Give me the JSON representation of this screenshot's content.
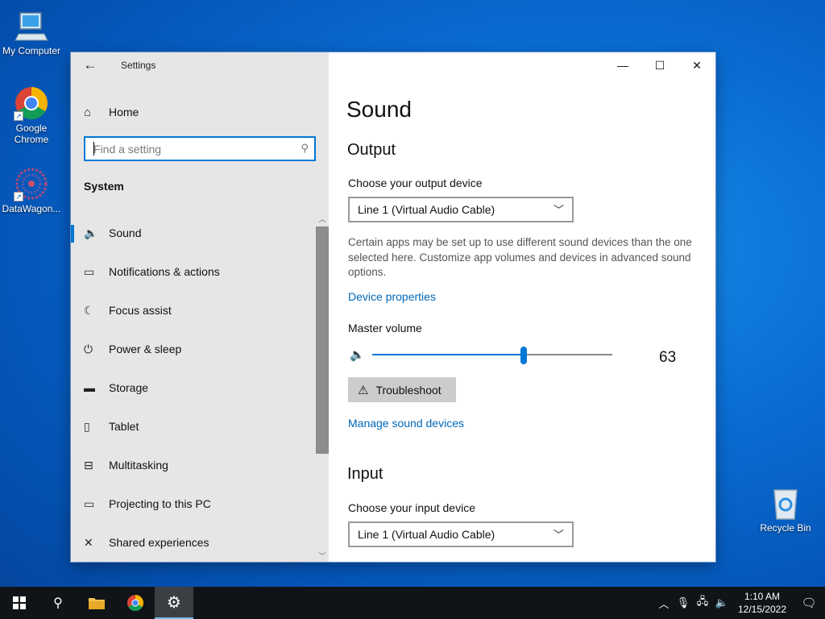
{
  "desktop": {
    "icons": [
      {
        "label": "My Computer",
        "icon": "computer-icon"
      },
      {
        "label": "Google Chrome",
        "icon": "chrome-icon"
      },
      {
        "label": "DataWagon...",
        "icon": "datawagon-icon"
      },
      {
        "label": "Recycle Bin",
        "icon": "recycle-bin-icon"
      }
    ]
  },
  "window": {
    "app_title": "Settings",
    "back_icon": "←",
    "minimize": "—",
    "maximize": "☐",
    "close": "✕"
  },
  "sidebar": {
    "home_label": "Home",
    "search_placeholder": "Find a setting",
    "section_title": "System",
    "items": [
      {
        "label": "Sound",
        "icon": "🔈",
        "active": true
      },
      {
        "label": "Notifications & actions",
        "icon": "▭"
      },
      {
        "label": "Focus assist",
        "icon": "☾"
      },
      {
        "label": "Power & sleep",
        "icon": "⏻"
      },
      {
        "label": "Storage",
        "icon": "▬"
      },
      {
        "label": "Tablet",
        "icon": "▯"
      },
      {
        "label": "Multitasking",
        "icon": "⊟"
      },
      {
        "label": "Projecting to this PC",
        "icon": "▭"
      },
      {
        "label": "Shared experiences",
        "icon": "✕"
      }
    ]
  },
  "main": {
    "title": "Sound",
    "output": {
      "heading": "Output",
      "device_label": "Choose your output device",
      "device_value": "Line 1 (Virtual Audio Cable)",
      "description": "Certain apps may be set up to use different sound devices than the one selected here. Customize app volumes and devices in advanced sound options.",
      "device_properties_link": "Device properties",
      "master_volume_label": "Master volume",
      "volume": 63,
      "volume_text": "63",
      "troubleshoot_label": "Troubleshoot",
      "manage_link": "Manage sound devices"
    },
    "input": {
      "heading": "Input",
      "device_label": "Choose your input device",
      "device_value": "Line 1 (Virtual Audio Cable)"
    }
  },
  "taskbar": {
    "time": "1:10 AM",
    "date": "12/15/2022"
  },
  "colors": {
    "accent": "#0078d7",
    "link": "#0067b8",
    "sidebar_bg": "#e6e6e6"
  }
}
